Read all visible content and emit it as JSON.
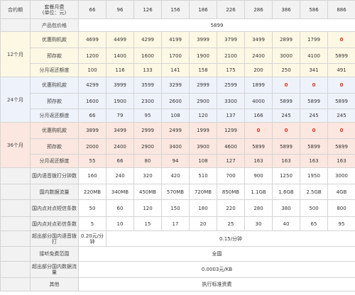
{
  "header": {
    "term_label": "合约期",
    "plan_label_line1": "套餐月费",
    "plan_label_line2": "(单位：元)",
    "plans": [
      "66",
      "96",
      "126",
      "156",
      "186",
      "226",
      "286",
      "386",
      "586",
      "886"
    ]
  },
  "product_price": {
    "label": "产品包价格",
    "value": "5899"
  },
  "groups": [
    {
      "term": "12个月",
      "rows": [
        {
          "label": "优惠购机款",
          "values": [
            "4699",
            "4499",
            "4299",
            "4199",
            "3999",
            "3799",
            "3499",
            "2899",
            "1799",
            "0"
          ]
        },
        {
          "label": "预存款",
          "values": [
            "1200",
            "1400",
            "1600",
            "1700",
            "1900",
            "2100",
            "2400",
            "3000",
            "4100",
            "5899"
          ]
        },
        {
          "label": "分月返还额度",
          "values": [
            "100",
            "116",
            "133",
            "141",
            "158",
            "175",
            "200",
            "250",
            "341",
            "491"
          ]
        }
      ]
    },
    {
      "term": "24个月",
      "rows": [
        {
          "label": "优惠购机款",
          "values": [
            "4299",
            "3999",
            "3599",
            "3299",
            "2999",
            "2599",
            "1899",
            "0",
            "0",
            "0"
          ]
        },
        {
          "label": "预存款",
          "values": [
            "1600",
            "1900",
            "2300",
            "2600",
            "2900",
            "3300",
            "4000",
            "5899",
            "5899",
            "5899"
          ]
        },
        {
          "label": "分月返还额度",
          "values": [
            "66",
            "79",
            "95",
            "108",
            "120",
            "137",
            "166",
            "245",
            "245",
            "245"
          ]
        }
      ]
    },
    {
      "term": "36个月",
      "rows": [
        {
          "label": "优惠购机款",
          "values": [
            "3899",
            "3499",
            "2999",
            "2499",
            "1999",
            "1299",
            "0",
            "0",
            "0",
            "0"
          ]
        },
        {
          "label": "预存款",
          "values": [
            "2000",
            "2400",
            "2900",
            "3400",
            "3900",
            "4600",
            "5899",
            "5899",
            "5899",
            "5899"
          ]
        },
        {
          "label": "分月返还额度",
          "values": [
            "55",
            "66",
            "80",
            "94",
            "108",
            "127",
            "163",
            "163",
            "163",
            "163"
          ]
        }
      ]
    }
  ],
  "features": {
    "voice": {
      "label": "国内语音拨打分钟数",
      "values": [
        "160",
        "240",
        "320",
        "420",
        "510",
        "700",
        "900",
        "1250",
        "1950",
        "3000"
      ]
    },
    "data": {
      "label": "国内数据流量",
      "values": [
        "220MB",
        "340MB",
        "450MB",
        "570MB",
        "720MB",
        "850MB",
        "1.1GB",
        "1.6GB",
        "2.5GB",
        "4GB"
      ]
    },
    "sms": {
      "label": "国内点对点短信条数",
      "values": [
        "50",
        "60",
        "120",
        "150",
        "180",
        "220",
        "280",
        "380",
        "500",
        "800"
      ]
    },
    "mms": {
      "label": "国内点对点彩信条数",
      "values": [
        "5",
        "10",
        "15",
        "17",
        "20",
        "25",
        "30",
        "40",
        "65",
        "95"
      ]
    },
    "overage_voice": {
      "label": "超出部分国内语音拨打",
      "first": "0.20元/分钟",
      "rest": "0.15/分钟"
    },
    "free_answer": {
      "label": "接听免费范围",
      "value": "全国"
    },
    "overage_data": {
      "label": "超出部分国内数据流量",
      "value": "0.0003元/KB"
    },
    "other": {
      "label": "其他",
      "value": "执行标准资费"
    }
  }
}
